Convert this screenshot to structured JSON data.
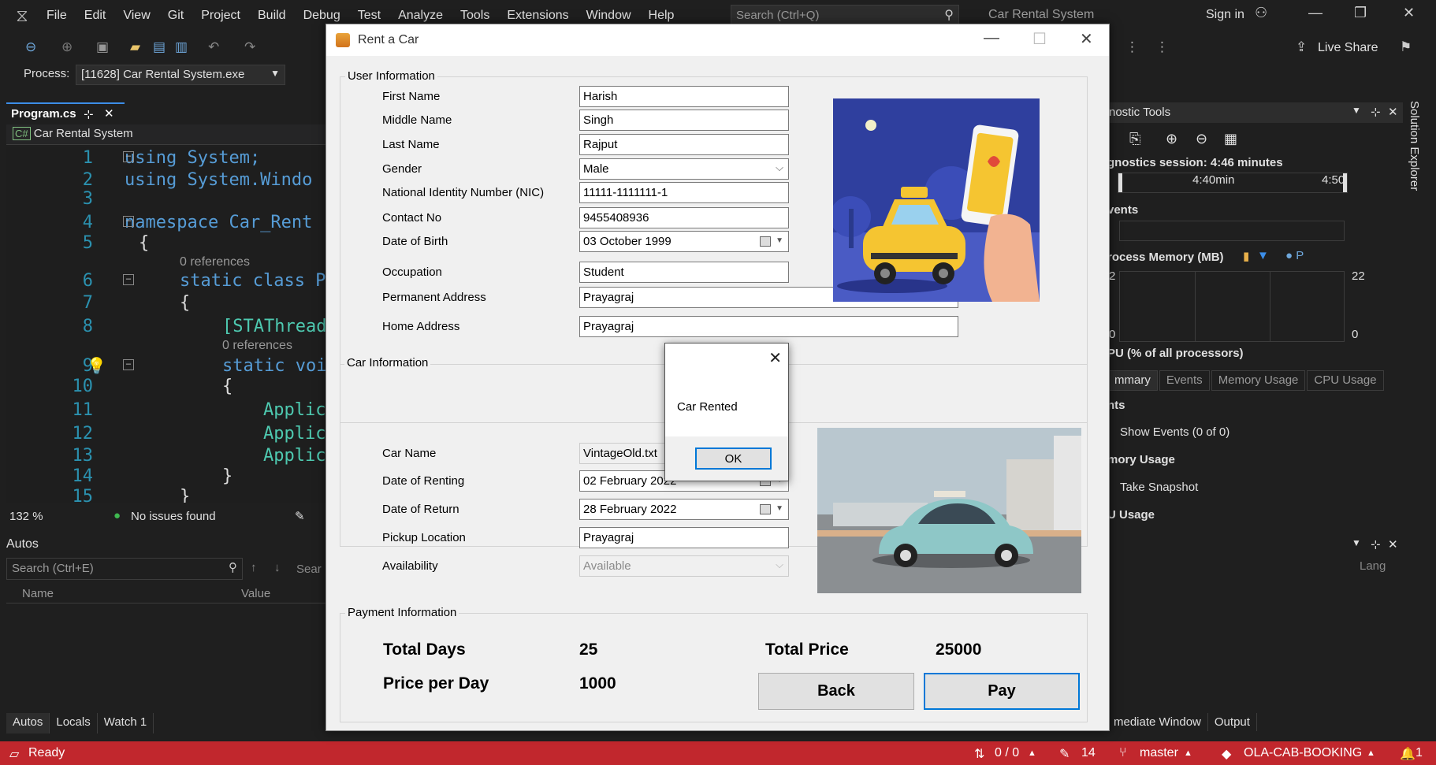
{
  "vs": {
    "menu": [
      "File",
      "Edit",
      "View",
      "Git",
      "Project",
      "Build",
      "Debug",
      "Test",
      "Analyze",
      "Tools",
      "Extensions",
      "Window",
      "Help"
    ],
    "search_placeholder": "Search (Ctrl+Q)",
    "solution_name": "Car Rental System",
    "sign_in": "Sign in",
    "live_share": "Live Share",
    "process_label": "Process:",
    "process_value": "[11628] Car Rental System.exe",
    "editor_tab": "Program.cs",
    "nav_project": "Car Rental System",
    "code_lines": [
      {
        "n": "1",
        "text": "using System;"
      },
      {
        "n": "2",
        "text": "using System.Windo"
      },
      {
        "n": "3",
        "text": ""
      },
      {
        "n": "4",
        "text": "namespace Car_Rent"
      },
      {
        "n": "5",
        "text": "{"
      },
      {
        "n": "6",
        "text": "static class P"
      },
      {
        "n": "7",
        "text": "{"
      },
      {
        "n": "8",
        "text": "[STAThread"
      },
      {
        "n": "9",
        "text": "static voi"
      },
      {
        "n": "10",
        "text": "{"
      },
      {
        "n": "11",
        "text": "Applic"
      },
      {
        "n": "12",
        "text": "Applic"
      },
      {
        "n": "13",
        "text": "Applic"
      },
      {
        "n": "14",
        "text": "}"
      },
      {
        "n": "15",
        "text": "}"
      }
    ],
    "references_label": "0 references",
    "zoom": "132 %",
    "issues": "No issues found",
    "autos_title": "Autos",
    "autos_search": "Search (Ctrl+E)",
    "autos_search_depth": "Sear",
    "autos_cols": {
      "name": "Name",
      "value": "Value"
    },
    "bottom_tabs": [
      "Autos",
      "Locals",
      "Watch 1"
    ],
    "diag": {
      "title": "nostic Tools",
      "session": "gnostics session: 4:46 minutes",
      "tick1": "4:40min",
      "tick2": "4:50",
      "events": "vents",
      "process_memory": "rocess Memory (MB)",
      "mem_left_top": "2",
      "mem_right_top": "22",
      "mem_left_bottom": "0",
      "mem_right_bottom": "0",
      "cpu": "PU (% of all processors)",
      "tabs": [
        "mmary",
        "Events",
        "Memory Usage",
        "CPU Usage"
      ],
      "sec_events": "nts",
      "show_events": "Show Events (0 of 0)",
      "sec_memory": "mory Usage",
      "take_snapshot": "Take Snapshot",
      "sec_cpu": "U Usage",
      "lang": "Lang"
    },
    "solution_explorer": "Solution Explorer",
    "bottom_right_tabs": [
      "mediate Window",
      "Output"
    ],
    "status": {
      "ready": "Ready",
      "line_info": "0 / 0",
      "edits": "14",
      "branch": "master",
      "repo": "OLA-CAB-BOOKING",
      "notifications": "1"
    }
  },
  "dialog": {
    "title": "Rent a Car",
    "user_group": "User Information",
    "car_group": "Car Information",
    "payment_group": "Payment Information",
    "user_fields": [
      {
        "label": "First Name",
        "value": "Harish"
      },
      {
        "label": "Middle Name",
        "value": "Singh"
      },
      {
        "label": "Last Name",
        "value": "Rajput"
      },
      {
        "label": "Gender",
        "value": "Male"
      },
      {
        "label": "National Identity Number (NIC)",
        "value": "11111-1111111-1"
      },
      {
        "label": "Contact No",
        "value": "9455408936"
      },
      {
        "label": "Date of Birth",
        "value": "03   October   1999"
      },
      {
        "label": "Occupation",
        "value": "Student"
      },
      {
        "label": "Permanent Address",
        "value": "Prayagraj"
      },
      {
        "label": "Home Address",
        "value": "Prayagraj"
      }
    ],
    "car_fields": [
      {
        "label": "Car Name",
        "value": "VintageOld.txt"
      },
      {
        "label": "Date of Renting",
        "value": "02   February   2022"
      },
      {
        "label": "Date of Return",
        "value": "28   February   2022"
      },
      {
        "label": "Pickup Location",
        "value": "Prayagraj"
      },
      {
        "label": "Availability",
        "value": "Available"
      }
    ],
    "payment": {
      "total_days_label": "Total Days",
      "total_days": "25",
      "price_per_day_label": "Price per Day",
      "price_per_day": "1000",
      "total_price_label": "Total Price",
      "total_price": "25000"
    },
    "buttons": {
      "back": "Back",
      "pay": "Pay"
    }
  },
  "messagebox": {
    "text": "Car Rented",
    "ok": "OK"
  }
}
